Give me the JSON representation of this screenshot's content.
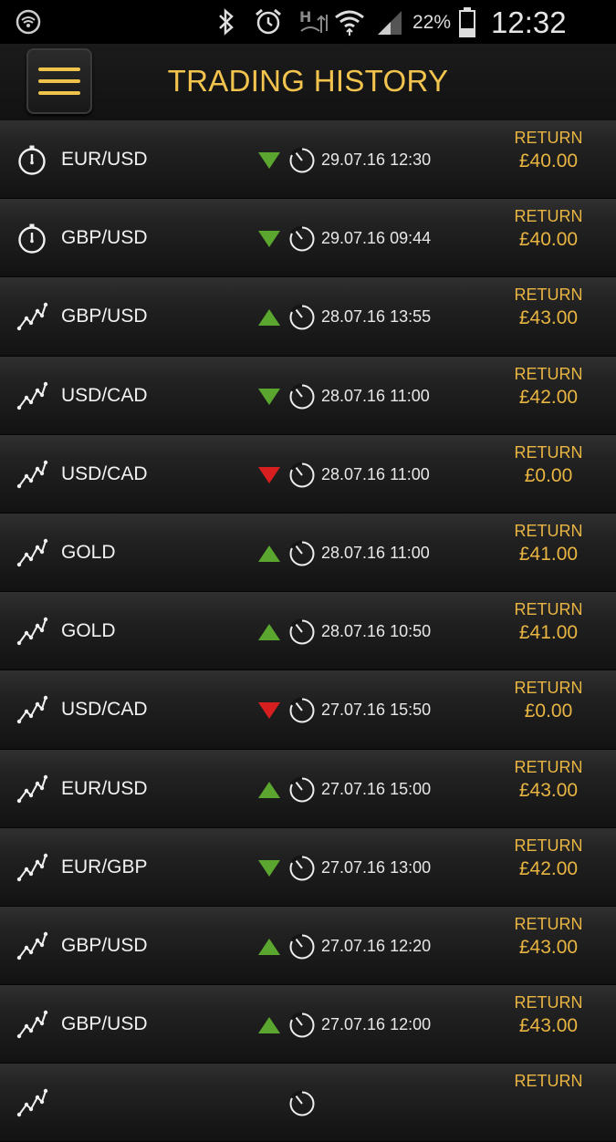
{
  "status_bar": {
    "battery_percent": "22%",
    "time": "12:32 pm"
  },
  "header": {
    "title": "TRADING HISTORY",
    "menu_icon": "hamburger-icon"
  },
  "colors": {
    "accent": "#f2c44e",
    "up": "#5aa62e",
    "down": "#d81f1f"
  },
  "trades": [
    {
      "kind": "stopwatch",
      "pair": "EUR/USD",
      "direction": "down",
      "outcome": "win",
      "datetime": "29.07.16 12:30",
      "return_label": "RETURN",
      "return_value": "£40.00"
    },
    {
      "kind": "stopwatch",
      "pair": "GBP/USD",
      "direction": "down",
      "outcome": "win",
      "datetime": "29.07.16 09:44",
      "return_label": "RETURN",
      "return_value": "£40.00"
    },
    {
      "kind": "chart",
      "pair": "GBP/USD",
      "direction": "up",
      "outcome": "win",
      "datetime": "28.07.16 13:55",
      "return_label": "RETURN",
      "return_value": "£43.00"
    },
    {
      "kind": "chart",
      "pair": "USD/CAD",
      "direction": "down",
      "outcome": "win",
      "datetime": "28.07.16 11:00",
      "return_label": "RETURN",
      "return_value": "£42.00"
    },
    {
      "kind": "chart",
      "pair": "USD/CAD",
      "direction": "down",
      "outcome": "loss",
      "datetime": "28.07.16 11:00",
      "return_label": "RETURN",
      "return_value": "£0.00"
    },
    {
      "kind": "chart",
      "pair": "GOLD",
      "direction": "up",
      "outcome": "win",
      "datetime": "28.07.16 11:00",
      "return_label": "RETURN",
      "return_value": "£41.00"
    },
    {
      "kind": "chart",
      "pair": "GOLD",
      "direction": "up",
      "outcome": "win",
      "datetime": "28.07.16 10:50",
      "return_label": "RETURN",
      "return_value": "£41.00"
    },
    {
      "kind": "chart",
      "pair": "USD/CAD",
      "direction": "down",
      "outcome": "loss",
      "datetime": "27.07.16 15:50",
      "return_label": "RETURN",
      "return_value": "£0.00"
    },
    {
      "kind": "chart",
      "pair": "EUR/USD",
      "direction": "up",
      "outcome": "win",
      "datetime": "27.07.16 15:00",
      "return_label": "RETURN",
      "return_value": "£43.00"
    },
    {
      "kind": "chart",
      "pair": "EUR/GBP",
      "direction": "down",
      "outcome": "win",
      "datetime": "27.07.16 13:00",
      "return_label": "RETURN",
      "return_value": "£42.00"
    },
    {
      "kind": "chart",
      "pair": "GBP/USD",
      "direction": "up",
      "outcome": "win",
      "datetime": "27.07.16 12:20",
      "return_label": "RETURN",
      "return_value": "£43.00"
    },
    {
      "kind": "chart",
      "pair": "GBP/USD",
      "direction": "up",
      "outcome": "win",
      "datetime": "27.07.16 12:00",
      "return_label": "RETURN",
      "return_value": "£43.00"
    },
    {
      "kind": "chart",
      "pair": "",
      "direction": "",
      "outcome": "",
      "datetime": "",
      "return_label": "RETURN",
      "return_value": ""
    }
  ]
}
